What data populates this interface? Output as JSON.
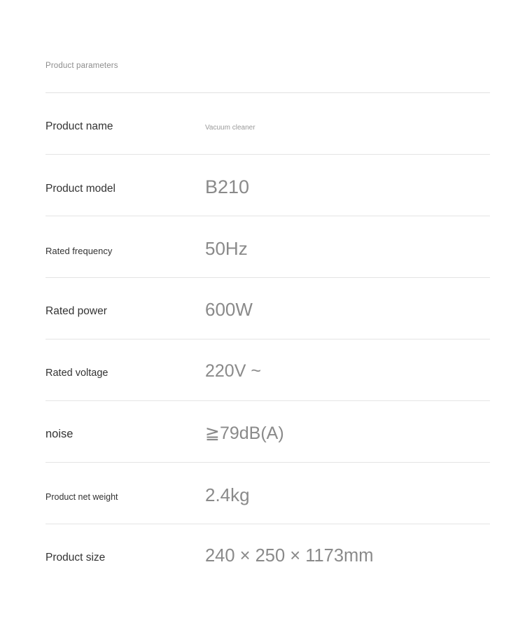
{
  "section": {
    "title": "Product parameters"
  },
  "colors": {
    "background": "#ffffff",
    "label_text": "#333333",
    "value_text": "#8a8a8a",
    "heading_text": "#8d8d8d",
    "divider": "#e4e4e4"
  },
  "parameters": [
    {
      "label": "Product name",
      "value": "Vacuum cleaner"
    },
    {
      "label": "Product model",
      "value": "B210"
    },
    {
      "label": "Rated frequency",
      "value": "50Hz"
    },
    {
      "label": "Rated power",
      "value": "600W"
    },
    {
      "label": "Rated voltage",
      "value": "220V ~"
    },
    {
      "label": "noise",
      "value": "≧79dB(A)"
    },
    {
      "label": "Product net weight",
      "value": "2.4kg"
    },
    {
      "label": "Product size",
      "value": "240 × 250 × 1173mm"
    }
  ]
}
